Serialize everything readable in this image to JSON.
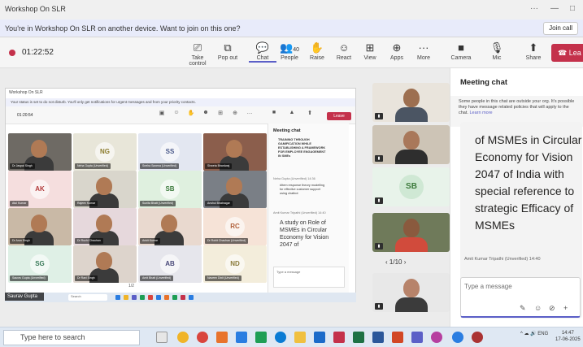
{
  "window": {
    "title": "Workshop On SLR",
    "controls": [
      "···",
      "—",
      "□"
    ]
  },
  "notice": {
    "message": "You're in Workshop On SLR on another device. Want to join on this one?",
    "join_label": "Join call"
  },
  "toolbar": {
    "timer": "01:22:52",
    "buttons": [
      {
        "label": "Take control",
        "icon": "take-control-icon",
        "glyph": "⎚"
      },
      {
        "label": "Pop out",
        "icon": "pop-out-icon",
        "glyph": "⧉"
      },
      {
        "label": "Chat",
        "icon": "chat-icon",
        "glyph": "💬"
      },
      {
        "label": "People",
        "icon": "people-icon",
        "glyph": "👥",
        "count": "40"
      },
      {
        "label": "Raise",
        "icon": "raise-hand-icon",
        "glyph": "✋"
      },
      {
        "label": "React",
        "icon": "react-icon",
        "glyph": "☺"
      },
      {
        "label": "View",
        "icon": "view-icon",
        "glyph": "⊞"
      },
      {
        "label": "Apps",
        "icon": "apps-icon",
        "glyph": "⊕"
      },
      {
        "label": "More",
        "icon": "more-icon",
        "glyph": "···"
      },
      {
        "label": "Camera",
        "icon": "camera-icon",
        "glyph": "■"
      },
      {
        "label": "Mic",
        "icon": "mic-off-icon",
        "glyph": "🎙"
      },
      {
        "label": "Share",
        "icon": "share-icon",
        "glyph": "⬆"
      }
    ],
    "leave_label": "Lea"
  },
  "shared_screen": {
    "title": "Workshop On SLR",
    "banner": "Your status is set to do not disturb. You'll only get notifications for urgent messages and from your priority contacts.",
    "time": "01:20:54",
    "leave_label": "Leave",
    "tiles": [
      {
        "initials": "",
        "name": "Dr Jaspal Singh",
        "bg": "#6e6a64"
      },
      {
        "initials": "NG",
        "name": "Neha Gupta (Unverified)",
        "bg": "#e8e6d9",
        "color": "#8a7a2a"
      },
      {
        "initials": "SS",
        "name": "Sneha Saxena (Unverified)",
        "bg": "#e3e7f1",
        "color": "#4b5a8a"
      },
      {
        "initials": "",
        "name": "Shweta Bhardwaj",
        "bg": "#8b5e4c"
      },
      {
        "initials": "AK",
        "name": "Atul Kumar",
        "bg": "#f5dede",
        "color": "#b23a3a"
      },
      {
        "initials": "",
        "name": "Rajeev Kumar",
        "bg": "#d9d6cc"
      },
      {
        "initials": "SB",
        "name": "Sunita Bhatt (Unverified)",
        "bg": "#dff0df",
        "color": "#3c7a3c"
      },
      {
        "initials": "",
        "name": "Anshul Bhatnagar",
        "bg": "#7a7f86"
      },
      {
        "initials": "",
        "name": "Dr Arun Singh",
        "bg": "#c9b9a6"
      },
      {
        "initials": "",
        "name": "Dr Ruchi Chauhan",
        "bg": "#e6d8dc"
      },
      {
        "initials": "",
        "name": "Ankit Kumar",
        "bg": "#e9d9cf"
      },
      {
        "initials": "RC",
        "name": "Dr Rohit Chauhan (Unverified)",
        "bg": "#f6e3d7",
        "color": "#b0603a"
      },
      {
        "initials": "SG",
        "name": "Saurav Gupta (Unverified)",
        "bg": "#dff0e6",
        "color": "#3a7a5a"
      },
      {
        "initials": "",
        "name": "Dr Ravi Singh",
        "bg": "#ddd4cc"
      },
      {
        "initials": "AB",
        "name": "Amit Bhatt (Unverified)",
        "bg": "#e6e6ec",
        "color": "#4a4a7a"
      },
      {
        "initials": "ND",
        "name": "Naveen Dixit (Unverified)",
        "bg": "#f3eddb",
        "color": "#8a7a3a"
      }
    ],
    "chat": {
      "title": "Meeting chat",
      "msg1": "TRAINING THROUGH GAMIFICATION WHILE ESTABLISHING A FRAMEWORK FOR EMPLOYEE ENGAGEMENT IN SMEs",
      "meta2": "Neha Gupta (Unverified)  14:36",
      "msg2": "#Item response theory modelling for effective customer support using chatbot",
      "meta3": "Amit Kumar Tripathi (Unverified)  14:40",
      "msg3": "A study on Role of MSMEs in Circular Economy for Vision 2047 of",
      "input_placeholder": "Type a message"
    },
    "pager": "1/2",
    "presenter": "Saurav Gupta",
    "taskbar_search": "Search"
  },
  "right_tiles": [
    {
      "name": "participant-1",
      "skin": "#9d6f50",
      "shirt": "#4b5563",
      "bg": "#e9e4dc"
    },
    {
      "name": "participant-2",
      "skin": "#a9785a",
      "shirt": "#2e2e2e",
      "bg": "#cdc4b6"
    },
    {
      "initials": "SB",
      "bg": "#e8f3ea",
      "color": "#3c7a3c"
    },
    {
      "name": "participant-4",
      "skin": "#8a5a3e",
      "shirt": "#d14b3c",
      "bg": "#6f7a5a"
    },
    {
      "name": "participant-5",
      "skin": "#b7836a",
      "shirt": "#3b3b3b",
      "bg": "#e8e8e8"
    }
  ],
  "right_pager": "1/10",
  "chat": {
    "title": "Meeting chat",
    "notice": "Some people in this chat are outside your org. It's possible they have message related policies that will apply to the chat.",
    "learn_more": "Learn more",
    "big_message": "of MSMEs in Circular Economy for Vision 2047 of India with special reference to strategic Efficacy of MSMEs",
    "meta": "Amit Kumar Tripathi (Unverified)  14:40",
    "input_placeholder": "Type a message"
  },
  "taskbar": {
    "search_placeholder": "Type here to search",
    "tray": "ENG",
    "time": "14:47",
    "date": "17-06-2025"
  },
  "colors": {
    "accent": "#5b5fc7",
    "leave": "#c4314b"
  }
}
